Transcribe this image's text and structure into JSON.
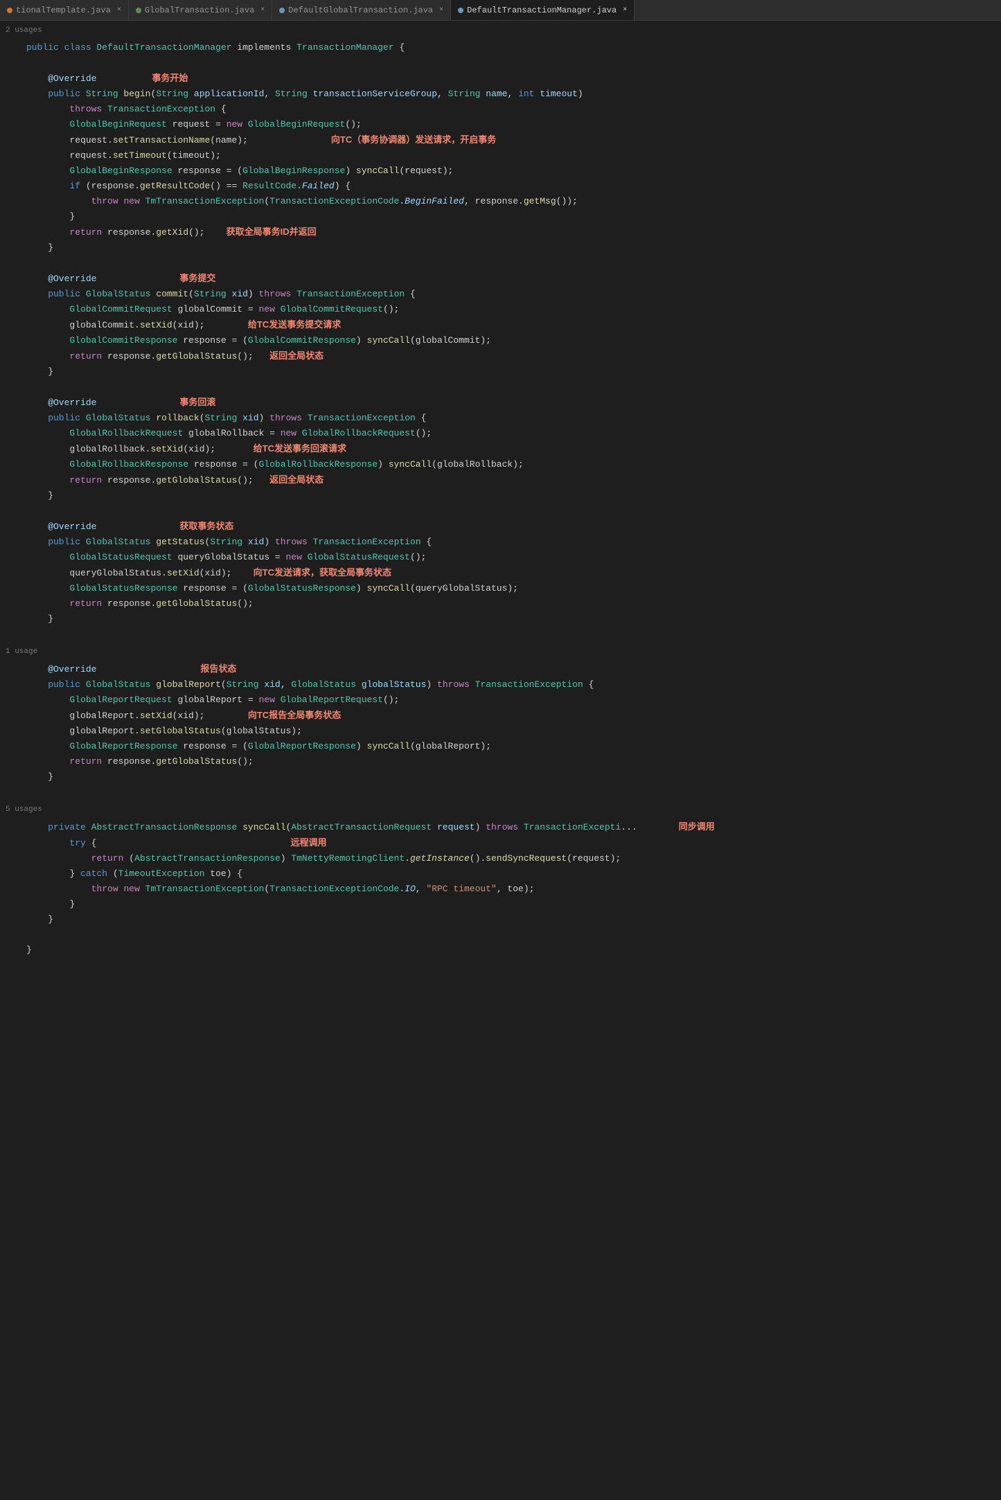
{
  "tabs": [
    {
      "label": "tionalTemplate.java",
      "color": "#cc7832",
      "active": false,
      "dot_color": "#cc7832"
    },
    {
      "label": "GlobalTransaction.java",
      "color": "#6a8759",
      "active": false,
      "dot_color": "#6a8759"
    },
    {
      "label": "DefaultGlobalTransaction.java",
      "color": "#6897bb",
      "active": false,
      "dot_color": "#6897bb"
    },
    {
      "label": "DefaultTransactionManager.java",
      "color": "#6897bb",
      "active": true,
      "dot_color": "#6897bb"
    }
  ],
  "usages_top": "2 usages",
  "usage_mid": "1 usage",
  "usage_bottom": "5 usages",
  "annotations": {
    "transaction_begin": "事务开始",
    "send_tc_begin": "向TC（事务协调器）发送请求，开启事务",
    "get_xid": "获取全局事务ID并返回",
    "transaction_commit": "事务提交",
    "send_tc_commit": "给TC发送事务提交请求",
    "return_global_status_commit": "返回全局状态",
    "transaction_rollback": "事务回滚",
    "send_tc_rollback": "给TC发送事务回滚请求",
    "return_global_status_rollback": "返回全局状态",
    "get_transaction_status": "获取事务状态",
    "send_tc_query": "向TC发送请求，获取全局事务状态",
    "report_status": "报告状态",
    "send_tc_report": "向TC报告全局事务状态",
    "sync_call": "同步调用",
    "remote_call": "远程调用"
  }
}
